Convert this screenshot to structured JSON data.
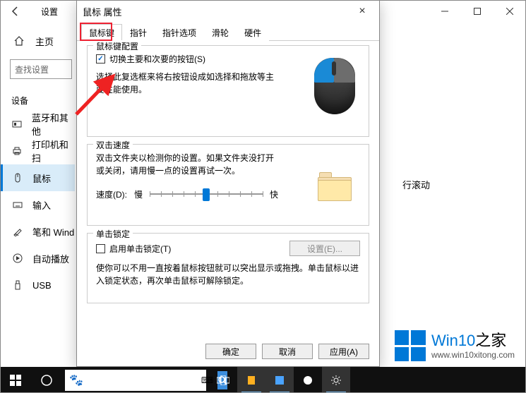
{
  "settings": {
    "title": "设置",
    "home": "主页",
    "search_placeholder": "查找设置",
    "section": "设备",
    "items": [
      {
        "label": "蓝牙和其他",
        "icon": "bluetooth"
      },
      {
        "label": "打印机和扫",
        "icon": "printer"
      },
      {
        "label": "鼠标",
        "icon": "mouse",
        "active": true
      },
      {
        "label": "输入",
        "icon": "keyboard"
      },
      {
        "label": "笔和 Wind",
        "icon": "pen"
      },
      {
        "label": "自动播放",
        "icon": "autoplay"
      },
      {
        "label": "USB",
        "icon": "usb"
      }
    ],
    "right_peek": "行滚动"
  },
  "dialog": {
    "title": "鼠标 属性",
    "tabs": [
      "鼠标键",
      "指针",
      "指针选项",
      "滑轮",
      "硬件"
    ],
    "active_tab": 0,
    "group_buttons": {
      "legend": "鼠标键配置",
      "checkbox_label": "切换主要和次要的按钮(S)",
      "checked": true,
      "desc": "选择此复选框来将右按钮设成如选择和拖放等主要性能使用。"
    },
    "group_double": {
      "legend": "双击速度",
      "desc": "双击文件夹以检测你的设置。如果文件夹没打开或关闭，请用慢一点的设置再试一次。",
      "speed_label": "速度(D):",
      "slow": "慢",
      "fast": "快",
      "slider_pos": 0.5
    },
    "group_lock": {
      "legend": "单击锁定",
      "checkbox_label": "启用单击锁定(T)",
      "checked": false,
      "settings_btn": "设置(E)...",
      "desc": "使你可以不用一直按着鼠标按钮就可以突出显示或拖拽。单击鼠标以进入锁定状态，再次单击鼠标可解除锁定。"
    },
    "buttons": {
      "ok": "确定",
      "cancel": "取消",
      "apply": "应用(A)"
    }
  },
  "watermark": {
    "brand1": "Win10",
    "brand2": "之家",
    "url": "www.win10xitong.com"
  },
  "taskbar": {
    "search_placeholder": ""
  }
}
